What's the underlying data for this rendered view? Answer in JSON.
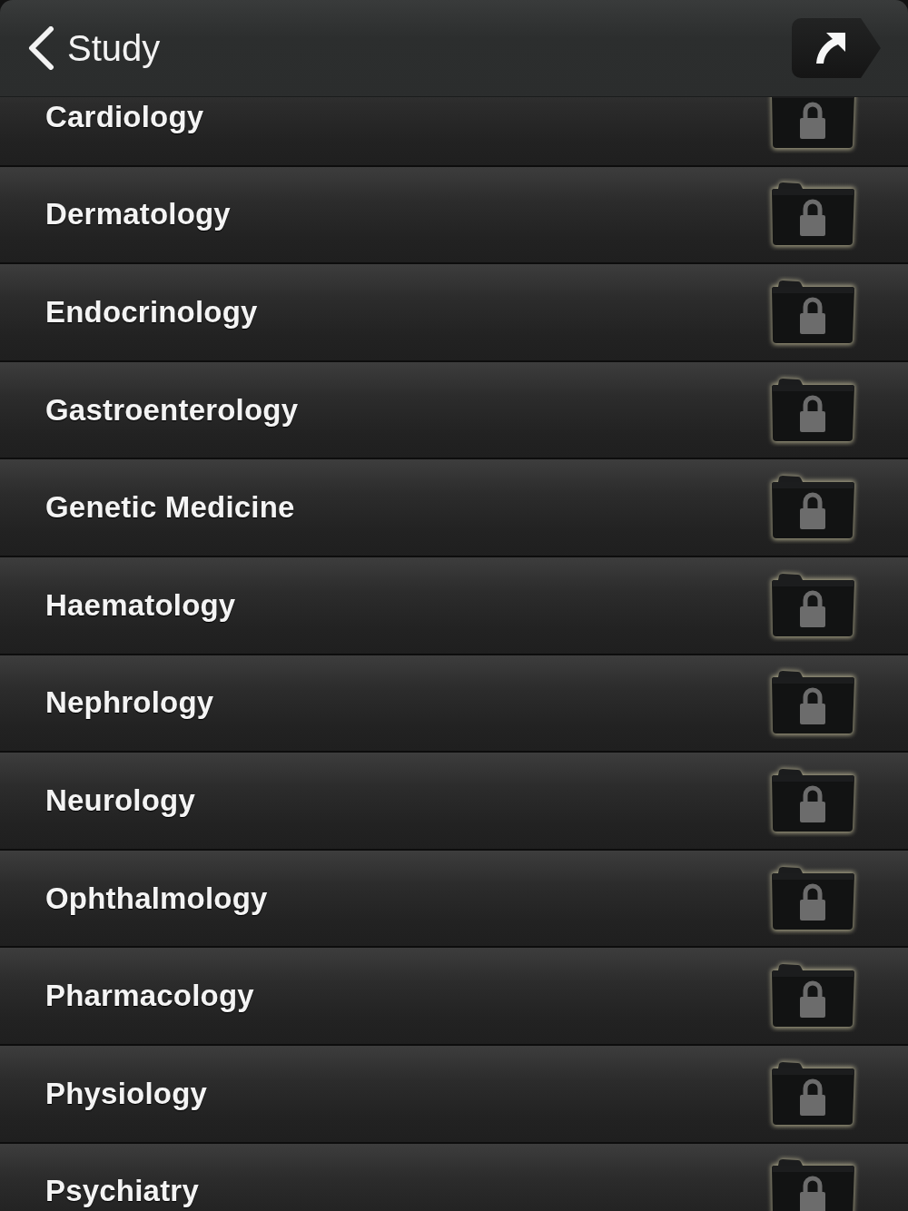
{
  "nav_bar": {
    "back_button": "Study"
  },
  "categories": [
    {
      "label": "Cardiology",
      "locked": true
    },
    {
      "label": "Dermatology",
      "locked": true
    },
    {
      "label": "Endocrinology",
      "locked": true
    },
    {
      "label": "Gastroenterology",
      "locked": true
    },
    {
      "label": "Genetic Medicine",
      "locked": true
    },
    {
      "label": "Haematology",
      "locked": true
    },
    {
      "label": "Nephrology",
      "locked": true
    },
    {
      "label": "Neurology",
      "locked": true
    },
    {
      "label": "Ophthalmology",
      "locked": true
    },
    {
      "label": "Pharmacology",
      "locked": true
    },
    {
      "label": "Physiology",
      "locked": true
    },
    {
      "label": "Psychiatry",
      "locked": true
    }
  ]
}
